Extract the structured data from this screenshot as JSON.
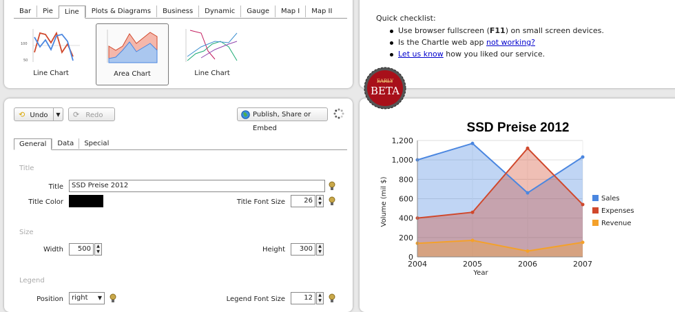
{
  "chart_types": {
    "tabs": [
      "Bar",
      "Pie",
      "Line",
      "Plots & Diagrams",
      "Business",
      "Dynamic",
      "Gauge",
      "Map I",
      "Map II"
    ],
    "active_tab": "Line",
    "thumbnails": [
      {
        "label": "Line Chart",
        "tick_top": "100",
        "tick_bottom": "50"
      },
      {
        "label": "Area Chart"
      },
      {
        "label": "Line Chart"
      }
    ]
  },
  "checklist": {
    "title": "Quick checklist:",
    "items": [
      {
        "pre": "Use browser fullscreen (",
        "bold": "F11",
        "post": ") on small screen devices."
      },
      {
        "pre": "Is the Chartle web app ",
        "link": "not working?",
        "post": ""
      },
      {
        "link": "Let us know",
        "post": " how you liked our service."
      }
    ],
    "badge": {
      "top": "EARLY",
      "main": "BETA"
    }
  },
  "toolbar": {
    "undo_label": "Undo",
    "redo_label": "Redo",
    "publish_label": "Publish, Share or Embed"
  },
  "editor_tabs": [
    "General",
    "Data",
    "Special"
  ],
  "form": {
    "title_section": "Title",
    "title_label": "Title",
    "title_value": "SSD Preise 2012",
    "title_color_label": "Title Color",
    "title_color": "#000000",
    "title_font_size_label": "Title Font Size",
    "title_font_size": "26",
    "size_section": "Size",
    "width_label": "Width",
    "width_value": "500",
    "height_label": "Height",
    "height_value": "300",
    "legend_section": "Legend",
    "position_label": "Position",
    "position_value": "right",
    "legend_font_size_label": "Legend Font Size",
    "legend_font_size": "12"
  },
  "chart_data": {
    "type": "area",
    "title": "SSD Preise 2012",
    "xlabel": "Year",
    "ylabel": "Volume (mil $)",
    "x": [
      "2004",
      "2005",
      "2006",
      "2007"
    ],
    "ylim": [
      0,
      1200
    ],
    "yticks": [
      "0",
      "200",
      "400",
      "600",
      "800",
      "1,000",
      "1,200"
    ],
    "grid": true,
    "legend": "right",
    "series": [
      {
        "name": "Sales",
        "values": [
          1000,
          1170,
          660,
          1030
        ],
        "color": "#4a86e0"
      },
      {
        "name": "Expenses",
        "values": [
          400,
          460,
          1120,
          540
        ],
        "color": "#d0482c"
      },
      {
        "name": "Revenue",
        "values": [
          140,
          170,
          60,
          150
        ],
        "color": "#f4a12a"
      }
    ]
  }
}
